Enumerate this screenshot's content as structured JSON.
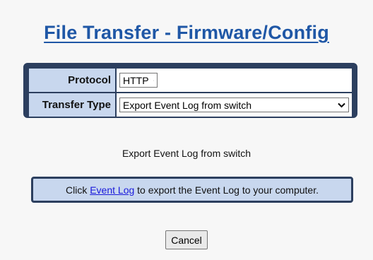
{
  "page": {
    "title": "File Transfer - Firmware/Config"
  },
  "settings": {
    "protocol_label": "Protocol",
    "protocol_value": "HTTP",
    "transfer_type_label": "Transfer Type",
    "transfer_type_value": "Export Event Log from switch"
  },
  "status": {
    "text": "Export Event Log from switch"
  },
  "info": {
    "prefix": "Click",
    "link_text": "Event Log",
    "suffix": "to export the Event Log to your computer."
  },
  "actions": {
    "cancel_label": "Cancel"
  },
  "colors": {
    "title": "#1f57a6",
    "box_border": "#2c3f5f",
    "label_bg": "#c8d7ee",
    "link": "#1a1adb"
  },
  "icons": {
    "dropdown": "chevron-down-icon"
  }
}
